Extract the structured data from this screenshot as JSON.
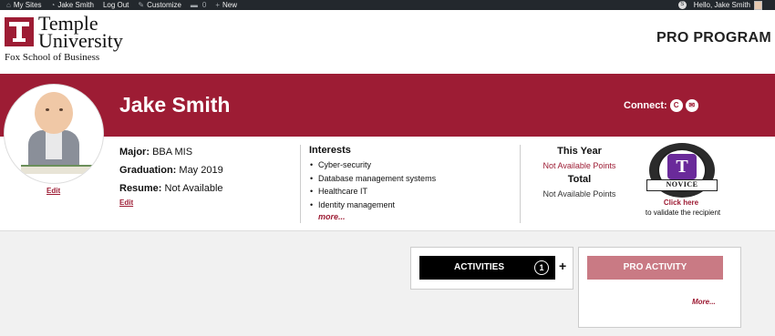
{
  "adminbar": {
    "items": [
      {
        "icon": "sites-icon",
        "glyph": "⌂",
        "label": "My Sites"
      },
      {
        "icon": "dashboard-icon",
        "glyph": "◔",
        "label": "Jake Smith"
      },
      {
        "icon": "",
        "glyph": "",
        "label": "Log Out"
      },
      {
        "icon": "brush-icon",
        "glyph": "✎",
        "label": "Customize"
      },
      {
        "icon": "comment-icon",
        "glyph": "▬",
        "label": "",
        "count": "0"
      },
      {
        "icon": "plus-icon",
        "glyph": "+",
        "label": "New"
      }
    ],
    "greeting": "Hello, Jake Smith",
    "circle_glyph": "S"
  },
  "header": {
    "logo_line1": "Temple",
    "logo_line2": "University",
    "logo_sub": "Fox School of Business",
    "program_title": "PRO PROGRAM"
  },
  "profile": {
    "name": "Jake Smith",
    "connect_label": "Connect:",
    "social_icons": [
      {
        "name": "ctemple-icon",
        "glyph": "C"
      },
      {
        "name": "email-icon",
        "glyph": "✉"
      }
    ],
    "avatar_edit": "Edit",
    "major_label": "Major:",
    "major_value": "BBA MIS",
    "graduation_label": "Graduation:",
    "graduation_value": "May 2019",
    "resume_label": "Resume:",
    "resume_value": "Not Available",
    "info_edit": "Edit"
  },
  "interests": {
    "title": "Interests",
    "items": [
      "Cyber-security",
      "Database management systems",
      "Healthcare IT",
      "Identity management"
    ],
    "more": "more..."
  },
  "points": {
    "this_year_label": "This Year",
    "this_year_value": "Not Available Points",
    "total_label": "Total",
    "total_value": "Not Available Points"
  },
  "badge": {
    "letter": "T",
    "ribbon": "NOVICE",
    "click_here": "Click here",
    "note": "to validate the recipient"
  },
  "activities": {
    "label": "ACTIVITIES",
    "count": "1",
    "plus": "+"
  },
  "pro_activity": {
    "label": "PRO ACTIVITY",
    "more": "More..."
  },
  "colors": {
    "brand_crimson": "#9d1c34",
    "admin_bar": "#23282d",
    "pro_button": "#c97a84"
  }
}
